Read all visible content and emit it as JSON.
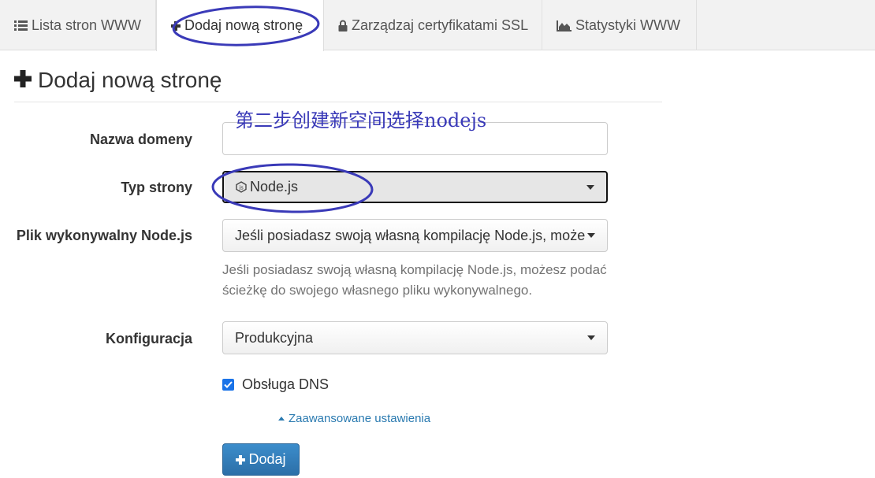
{
  "tabs": [
    {
      "label": "Lista stron WWW",
      "icon": "list-icon"
    },
    {
      "label": "Dodaj nową stronę",
      "icon": "plus-icon"
    },
    {
      "label": "Zarządzaj certyfikatami SSL",
      "icon": "lock-icon"
    },
    {
      "label": "Statystyki WWW",
      "icon": "area-chart-icon"
    }
  ],
  "page": {
    "title": "Dodaj nową stronę"
  },
  "annotation": {
    "text": "第二步创建新空间选择nodejs",
    "color": "#3a3ab8"
  },
  "form": {
    "domain": {
      "label": "Nazwa domeny",
      "value": ""
    },
    "site_type": {
      "label": "Typ strony",
      "value": "Node.js",
      "icon": "nodejs-icon"
    },
    "executable": {
      "label": "Plik wykonywalny Node.js",
      "value": "Jeśli posiadasz swoją własną kompilację Node.js, może",
      "help": "Jeśli posiadasz swoją własną kompilację Node.js, możesz podać ścieżkę do swojego własnego pliku wykonywalnego."
    },
    "config": {
      "label": "Konfiguracja",
      "value": "Produkcyjna"
    },
    "dns": {
      "label": "Obsługa DNS",
      "checked": true
    },
    "advanced_link": "Zaawansowane ustawienia",
    "submit_label": "Dodaj"
  },
  "colors": {
    "accent": "#2c6fa8",
    "link": "#2a7ab0",
    "checkbox": "#1a73e8"
  }
}
